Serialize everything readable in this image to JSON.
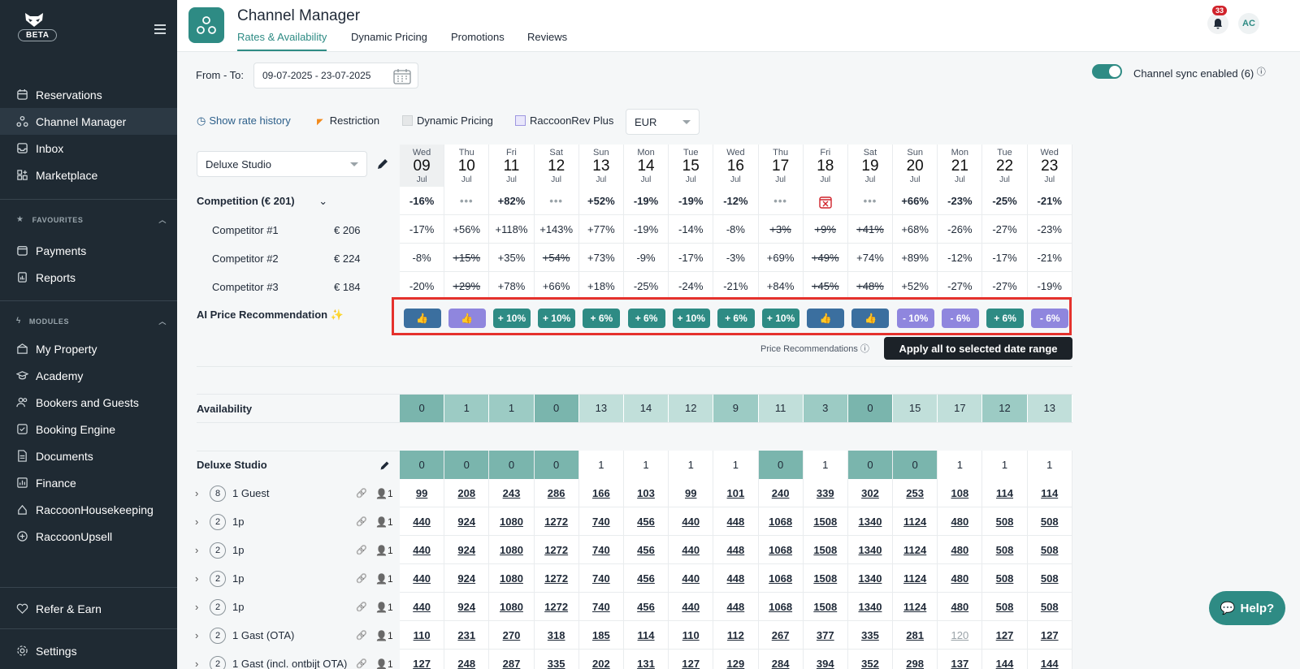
{
  "sidebar": {
    "beta_label": "BETA",
    "items_top": [
      {
        "label": "Reservations",
        "icon": "calendar-icon"
      },
      {
        "label": "Channel Manager",
        "icon": "network-icon"
      },
      {
        "label": "Inbox",
        "icon": "inbox-icon"
      },
      {
        "label": "Marketplace",
        "icon": "grid-plus-icon"
      }
    ],
    "favourites_title": "FAVOURITES",
    "favourites": [
      {
        "label": "Payments",
        "icon": "wallet-icon"
      },
      {
        "label": "Reports",
        "icon": "report-icon"
      }
    ],
    "modules_title": "MODULES",
    "modules": [
      {
        "label": "My Property",
        "icon": "building-icon"
      },
      {
        "label": "Academy",
        "icon": "graduation-icon"
      },
      {
        "label": "Bookers and Guests",
        "icon": "users-icon"
      },
      {
        "label": "Booking Engine",
        "icon": "booking-icon"
      },
      {
        "label": "Documents",
        "icon": "document-icon"
      },
      {
        "label": "Finance",
        "icon": "finance-icon"
      },
      {
        "label": "RaccoonHousekeeping",
        "icon": "housekeeping-icon"
      },
      {
        "label": "RaccoonUpsell",
        "icon": "plus-circle-icon"
      }
    ],
    "refer": "Refer & Earn",
    "settings": "Settings"
  },
  "header": {
    "title": "Channel Manager",
    "tabs": [
      "Rates & Availability",
      "Dynamic Pricing",
      "Promotions",
      "Reviews"
    ],
    "notifications": "33",
    "avatar": "AC"
  },
  "filters": {
    "from_to_label": "From - To:",
    "date_range": "09-07-2025 - 23-07-2025",
    "sync_label": "Channel sync enabled (6)",
    "show_rate_history": "Show rate history",
    "legend_restriction": "Restriction",
    "legend_dynamic": "Dynamic Pricing",
    "legend_raccoonrev": "RaccoonRev Plus",
    "currency": "EUR",
    "room_select": "Deluxe Studio"
  },
  "dates": [
    {
      "dow": "Wed",
      "day": "09",
      "mon": "Jul"
    },
    {
      "dow": "Thu",
      "day": "10",
      "mon": "Jul"
    },
    {
      "dow": "Fri",
      "day": "11",
      "mon": "Jul"
    },
    {
      "dow": "Sat",
      "day": "12",
      "mon": "Jul"
    },
    {
      "dow": "Sun",
      "day": "13",
      "mon": "Jul"
    },
    {
      "dow": "Mon",
      "day": "14",
      "mon": "Jul"
    },
    {
      "dow": "Tue",
      "day": "15",
      "mon": "Jul"
    },
    {
      "dow": "Wed",
      "day": "16",
      "mon": "Jul"
    },
    {
      "dow": "Thu",
      "day": "17",
      "mon": "Jul"
    },
    {
      "dow": "Fri",
      "day": "18",
      "mon": "Jul"
    },
    {
      "dow": "Sat",
      "day": "19",
      "mon": "Jul"
    },
    {
      "dow": "Sun",
      "day": "20",
      "mon": "Jul"
    },
    {
      "dow": "Mon",
      "day": "21",
      "mon": "Jul"
    },
    {
      "dow": "Tue",
      "day": "22",
      "mon": "Jul"
    },
    {
      "dow": "Wed",
      "day": "23",
      "mon": "Jul"
    }
  ],
  "competition": {
    "label": "Competition (€ 201)",
    "values": [
      "-16%",
      "...",
      "+82%",
      "...",
      "+52%",
      "-19%",
      "-19%",
      "-12%",
      "...",
      "closed",
      "...",
      "+66%",
      "-23%",
      "-25%",
      "-21%"
    ],
    "competitors": [
      {
        "name": "Competitor #1",
        "price": "€ 206",
        "values": [
          "-17%",
          "+56%",
          "+118%",
          "+143%",
          "+77%",
          "-19%",
          "-14%",
          "-8%",
          "~+3%",
          "~+9%",
          "~+41%",
          "+68%",
          "-26%",
          "-27%",
          "-23%"
        ]
      },
      {
        "name": "Competitor #2",
        "price": "€ 224",
        "values": [
          "-8%",
          "~+15%",
          "+35%",
          "~+54%",
          "+73%",
          "-9%",
          "-17%",
          "-3%",
          "+69%",
          "~+49%",
          "+74%",
          "+89%",
          "-12%",
          "-17%",
          "-21%"
        ]
      },
      {
        "name": "Competitor #3",
        "price": "€ 184",
        "values": [
          "-20%",
          "~+29%",
          "+78%",
          "+66%",
          "+18%",
          "-25%",
          "-24%",
          "-21%",
          "+84%",
          "~+45%",
          "~+48%",
          "+52%",
          "-27%",
          "-27%",
          "-19%"
        ]
      }
    ]
  },
  "ai": {
    "label": "AI Price Recommendation ✨",
    "recs": [
      {
        "text": "thumb",
        "style": "blue"
      },
      {
        "text": "thumb",
        "style": "purple"
      },
      {
        "text": "+ 10%",
        "style": "teal"
      },
      {
        "text": "+ 10%",
        "style": "teal"
      },
      {
        "text": "+ 6%",
        "style": "teal"
      },
      {
        "text": "+ 6%",
        "style": "teal"
      },
      {
        "text": "+ 10%",
        "style": "teal"
      },
      {
        "text": "+ 6%",
        "style": "teal"
      },
      {
        "text": "+ 10%",
        "style": "teal"
      },
      {
        "text": "thumb",
        "style": "blue"
      },
      {
        "text": "thumb",
        "style": "blue"
      },
      {
        "text": "- 10%",
        "style": "purple"
      },
      {
        "text": "- 6%",
        "style": "purple"
      },
      {
        "text": "+ 6%",
        "style": "teal"
      },
      {
        "text": "- 6%",
        "style": "purple"
      }
    ],
    "price_recs_label": "Price Recommendations",
    "apply_label": "Apply all to selected date range"
  },
  "availability": {
    "label": "Availability",
    "values": [
      "0",
      "1",
      "1",
      "0",
      "13",
      "14",
      "12",
      "9",
      "11",
      "3",
      "0",
      "15",
      "17",
      "12",
      "13"
    ],
    "levels": [
      0,
      1,
      1,
      0,
      2,
      2,
      2,
      1,
      2,
      1,
      0,
      2,
      2,
      1,
      2
    ]
  },
  "room": {
    "label": "Deluxe Studio",
    "values": [
      "0",
      "0",
      "0",
      "0",
      "1",
      "1",
      "1",
      "1",
      "0",
      "1",
      "0",
      "0",
      "1",
      "1",
      "1"
    ]
  },
  "rates": [
    {
      "count": "8",
      "name": "1 Guest",
      "guests": "1",
      "values": [
        "99",
        "208",
        "243",
        "286",
        "166",
        "103",
        "99",
        "101",
        "240",
        "339",
        "302",
        "253",
        "108",
        "114",
        "114"
      ]
    },
    {
      "count": "2",
      "name": "1p",
      "guests": "1",
      "values": [
        "440",
        "924",
        "1080",
        "1272",
        "740",
        "456",
        "440",
        "448",
        "1068",
        "1508",
        "1340",
        "1124",
        "480",
        "508",
        "508"
      ]
    },
    {
      "count": "2",
      "name": "1p",
      "guests": "1",
      "values": [
        "440",
        "924",
        "1080",
        "1272",
        "740",
        "456",
        "440",
        "448",
        "1068",
        "1508",
        "1340",
        "1124",
        "480",
        "508",
        "508"
      ]
    },
    {
      "count": "2",
      "name": "1p",
      "guests": "1",
      "values": [
        "440",
        "924",
        "1080",
        "1272",
        "740",
        "456",
        "440",
        "448",
        "1068",
        "1508",
        "1340",
        "1124",
        "480",
        "508",
        "508"
      ]
    },
    {
      "count": "2",
      "name": "1p",
      "guests": "1",
      "values": [
        "440",
        "924",
        "1080",
        "1272",
        "740",
        "456",
        "440",
        "448",
        "1068",
        "1508",
        "1340",
        "1124",
        "480",
        "508",
        "508"
      ]
    },
    {
      "count": "2",
      "name": "1 Gast (OTA)",
      "guests": "1",
      "values": [
        "110",
        "231",
        "270",
        "318",
        "185",
        "114",
        "110",
        "112",
        "267",
        "377",
        "335",
        "281",
        "120",
        "127",
        "127"
      ],
      "muted": [
        12
      ]
    },
    {
      "count": "2",
      "name": "1 Gast (incl. ontbijt OTA)",
      "guests": "1",
      "values": [
        "127",
        "248",
        "287",
        "335",
        "202",
        "131",
        "127",
        "129",
        "284",
        "394",
        "352",
        "298",
        "137",
        "144",
        "144"
      ]
    }
  ],
  "help_label": "Help?"
}
